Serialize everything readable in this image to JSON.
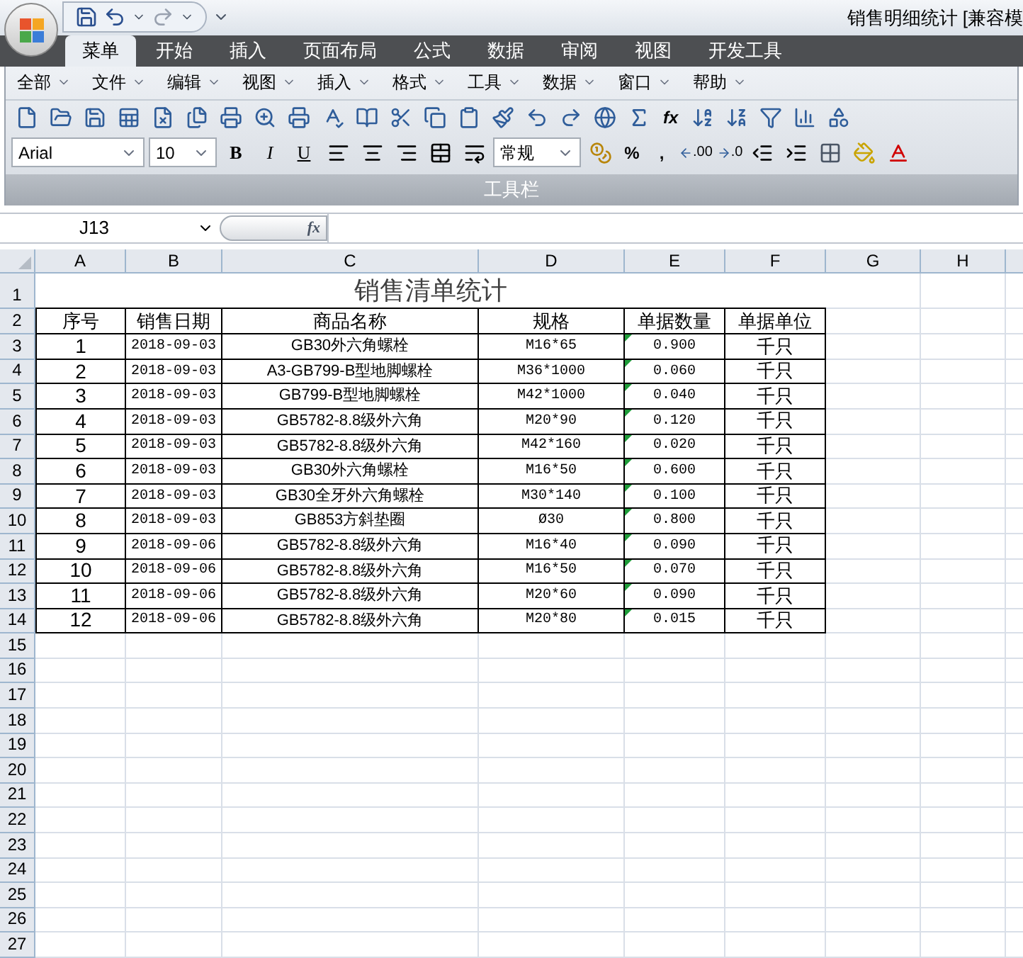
{
  "window": {
    "title": "销售明细统计  [兼容模"
  },
  "tabs": [
    {
      "label": "菜单",
      "selected": true
    },
    {
      "label": "开始",
      "selected": false
    },
    {
      "label": "插入",
      "selected": false
    },
    {
      "label": "页面布局",
      "selected": false
    },
    {
      "label": "公式",
      "selected": false
    },
    {
      "label": "数据",
      "selected": false
    },
    {
      "label": "审阅",
      "selected": false
    },
    {
      "label": "视图",
      "selected": false
    },
    {
      "label": "开发工具",
      "selected": false
    }
  ],
  "menus": [
    "全部",
    "文件",
    "编辑",
    "视图",
    "插入",
    "格式",
    "工具",
    "数据",
    "窗口",
    "帮助"
  ],
  "toolbar": {
    "function_button": "fx",
    "font": "Arial",
    "font_size": "10",
    "format_buttons": [
      "B",
      "I",
      "U"
    ],
    "number_format": "常规",
    "number_buttons": [
      "%",
      ","
    ],
    "decimal_buttons": [
      ".00",
      ".0"
    ],
    "group_label": "工具栏"
  },
  "formula_bar": {
    "name_box": "J13",
    "fx_label": "fx"
  },
  "sheet": {
    "columns": [
      "A",
      "B",
      "C",
      "D",
      "E",
      "F",
      "G",
      "H"
    ],
    "title": "销售清单统计",
    "headers": [
      "序号",
      "销售日期",
      "商品名称",
      "规格",
      "单据数量",
      "单据单位"
    ],
    "rows": [
      {
        "cells": [
          "1",
          "2018-09-03",
          "GB30外六角螺栓",
          "M16*65",
          "0.900",
          "千只"
        ],
        "flagged": true
      },
      {
        "cells": [
          "2",
          "2018-09-03",
          "A3-GB799-B型地脚螺栓",
          "M36*1000",
          "0.060",
          "千只"
        ],
        "flagged": true
      },
      {
        "cells": [
          "3",
          "2018-09-03",
          "GB799-B型地脚螺栓",
          "M42*1000",
          "0.040",
          "千只"
        ],
        "flagged": true
      },
      {
        "cells": [
          "4",
          "2018-09-03",
          "GB5782-8.8级外六角",
          "M20*90",
          "0.120",
          "千只"
        ],
        "flagged": true
      },
      {
        "cells": [
          "5",
          "2018-09-03",
          "GB5782-8.8级外六角",
          "M42*160",
          "0.020",
          "千只"
        ],
        "flagged": true
      },
      {
        "cells": [
          "6",
          "2018-09-03",
          "GB30外六角螺栓",
          "M16*50",
          "0.600",
          "千只"
        ],
        "flagged": true
      },
      {
        "cells": [
          "7",
          "2018-09-03",
          "GB30全牙外六角螺栓",
          "M30*140",
          "0.100",
          "千只"
        ],
        "flagged": true
      },
      {
        "cells": [
          "8",
          "2018-09-03",
          "GB853方斜垫圈",
          "Ø30",
          "0.800",
          "千只"
        ],
        "flagged": true
      },
      {
        "cells": [
          "9",
          "2018-09-06",
          "GB5782-8.8级外六角",
          "M16*40",
          "0.090",
          "千只"
        ],
        "flagged": true
      },
      {
        "cells": [
          "10",
          "2018-09-06",
          "GB5782-8.8级外六角",
          "M16*50",
          "0.070",
          "千只"
        ],
        "flagged": true
      },
      {
        "cells": [
          "11",
          "2018-09-06",
          "GB5782-8.8级外六角",
          "M20*60",
          "0.090",
          "千只"
        ],
        "flagged": true
      },
      {
        "cells": [
          "12",
          "2018-09-06",
          "GB5782-8.8级外六角",
          "M20*80",
          "0.015",
          "千只"
        ],
        "flagged": true
      }
    ],
    "row_numbers": [
      "1",
      "2",
      "3",
      "4",
      "5",
      "6",
      "7",
      "8",
      "9",
      "10",
      "11",
      "12",
      "13",
      "14",
      "15",
      "16",
      "17",
      "18",
      "19",
      "20",
      "21",
      "22",
      "23",
      "24",
      "25",
      "26",
      "27"
    ]
  }
}
